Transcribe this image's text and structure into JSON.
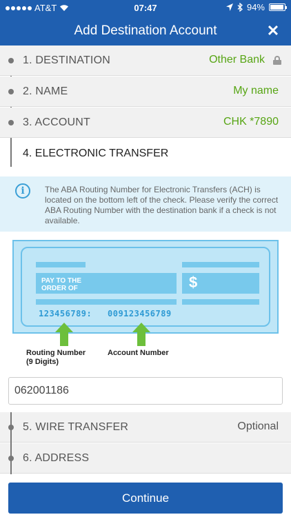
{
  "status_bar": {
    "carrier": "AT&T",
    "time": "07:47",
    "battery": "94%",
    "battery_level": 0.94
  },
  "nav": {
    "title": "Add Destination Account",
    "close_icon": "close-icon"
  },
  "steps": [
    {
      "label": "1. DESTINATION",
      "value": "Other Bank"
    },
    {
      "label": "2. NAME",
      "value": "My name"
    },
    {
      "label": "3. ACCOUNT",
      "value": "CHK *7890"
    },
    {
      "label": "4. ELECTRONIC TRANSFER",
      "value": ""
    },
    {
      "label": "5. WIRE TRANSFER",
      "value": "Optional"
    },
    {
      "label": "6. ADDRESS",
      "value": ""
    }
  ],
  "info": {
    "text": "The ABA Routing Number for Electronic Transfers (ACH) is located on the bottom left of the check. Please verify the correct ABA Routing Number with the destination bank if a check is not available."
  },
  "check": {
    "pay_to_line1": "PAY TO THE",
    "pay_to_line2": "ORDER OF",
    "dollar": "$",
    "routing_number": "123456789:",
    "account_number": "009123456789",
    "routing_caption_line1": "Routing Number",
    "routing_caption_line2": "(9 Digits)",
    "account_caption": "Account Number"
  },
  "routing_input": {
    "value": "062001186"
  },
  "continue_label": "Continue",
  "colors": {
    "primary": "#1f5fb0",
    "accent_green": "#57a514",
    "info_bg": "#e0f2fa",
    "check_blue": "#78c9ec"
  }
}
